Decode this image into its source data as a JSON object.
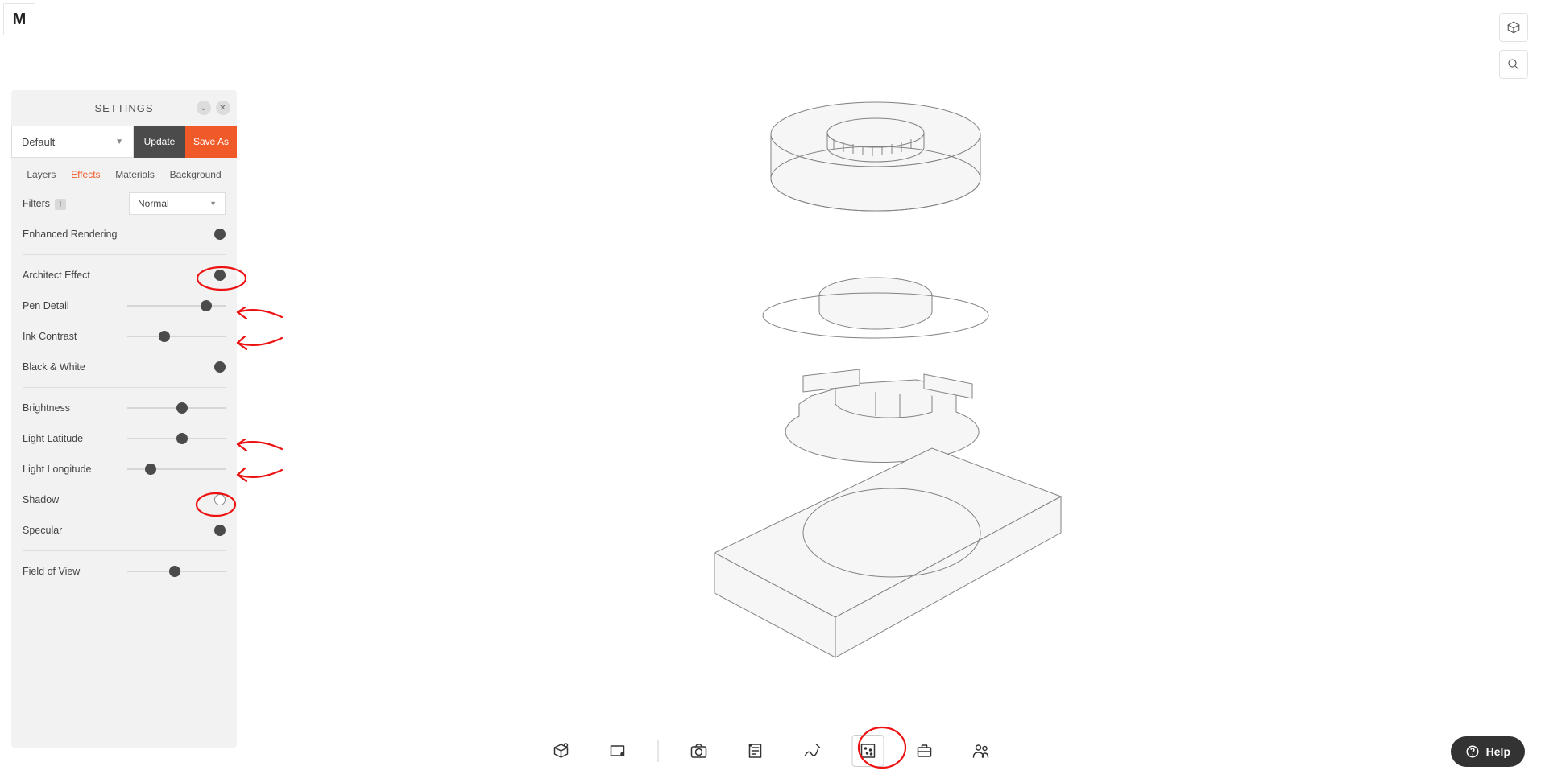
{
  "logo": "M",
  "rightTools": {
    "viewcube": "viewcube-icon",
    "search": "search-icon"
  },
  "panel": {
    "title": "SETTINGS",
    "collapse": "⌄",
    "close": "✕",
    "preset": "Default",
    "updateLabel": "Update",
    "saveAsLabel": "Save As",
    "tabs": {
      "layers": "Layers",
      "effects": "Effects",
      "materials": "Materials",
      "background": "Background"
    },
    "effects": {
      "filtersLabel": "Filters",
      "filterValue": "Normal",
      "enhancedLabel": "Enhanced Rendering",
      "enhancedOn": true,
      "architectLabel": "Architect Effect",
      "architectOn": true,
      "penDetailLabel": "Pen Detail",
      "penDetailPos": 80,
      "inkContrastLabel": "Ink Contrast",
      "inkContrastPos": 38,
      "bwLabel": "Black & White",
      "bwOn": true,
      "brightnessLabel": "Brightness",
      "brightnessPos": 56,
      "latLabel": "Light Latitude",
      "latPos": 56,
      "lonLabel": "Light Longitude",
      "lonPos": 24,
      "shadowLabel": "Shadow",
      "shadowOn": false,
      "specularLabel": "Specular",
      "specularOn": true,
      "fovLabel": "Field of View",
      "fovPos": 48
    }
  },
  "bottomToolbar": {
    "items": [
      "view3d-icon",
      "frame-icon",
      "camera-icon",
      "notes-icon",
      "draw-icon",
      "render-settings-icon",
      "toolbox-icon",
      "share-icon"
    ]
  },
  "help": {
    "label": "Help"
  }
}
